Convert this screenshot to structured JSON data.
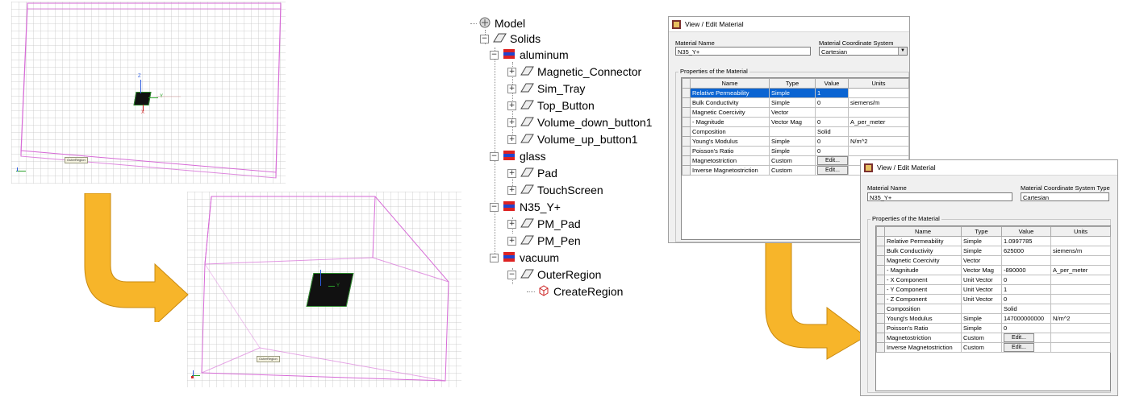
{
  "colors": {
    "region_outline": "#d66ad6",
    "arrow_orange": "#f7b52a",
    "arrow_outline": "#c98a10",
    "selection_blue": "#0a64d2",
    "solid_black": "#111111"
  },
  "viewport_top": {
    "region_tag": "OuterRegion",
    "axis_labels": {
      "z": "Z",
      "y": "Y",
      "x": "X"
    },
    "corner_label": "Z"
  },
  "viewport_bottom": {
    "region_tag": "OuterRegion",
    "axis_labels": {
      "z": "Z",
      "y": "Y"
    }
  },
  "tree": {
    "root": "Model",
    "solids": "Solids",
    "materials": [
      {
        "name": "aluminum",
        "children": [
          "Magnetic_Connector",
          "Sim_Tray",
          "Top_Button",
          "Volume_down_button1",
          "Volume_up_button1"
        ]
      },
      {
        "name": "glass",
        "children": [
          "Pad",
          "TouchScreen"
        ]
      },
      {
        "name": "N35_Y+",
        "children": [
          "PM_Pad",
          "PM_Pen"
        ]
      },
      {
        "name": "vacuum",
        "children": [
          "OuterRegion"
        ]
      }
    ],
    "leaf": "CreateRegion"
  },
  "dialog1": {
    "title": "View / Edit Material",
    "material_name_label": "Material Name",
    "material_name_value": "N35_Y+",
    "coord_label": "Material Coordinate System Type:",
    "coord_value": "Cartesian",
    "props_label": "Properties of the Material",
    "headers": [
      "Name",
      "Type",
      "Value",
      "Units"
    ],
    "rows": [
      [
        "Relative Permeability",
        "Simple",
        "1",
        ""
      ],
      [
        "Bulk Conductivity",
        "Simple",
        "0",
        "siemens/m"
      ],
      [
        "Magnetic Coercivity",
        "Vector",
        "",
        ""
      ],
      [
        "- Magnitude",
        "Vector Mag",
        "0",
        "A_per_meter"
      ],
      [
        "Composition",
        "",
        "Solid",
        ""
      ],
      [
        "Young's Modulus",
        "Simple",
        "0",
        "N/m^2"
      ],
      [
        "Poisson's Ratio",
        "Simple",
        "0",
        ""
      ],
      [
        "Magnetostriction",
        "Custom",
        "Edit...",
        ""
      ],
      [
        "Inverse Magnetostriction",
        "Custom",
        "Edit...",
        ""
      ]
    ]
  },
  "dialog2": {
    "title": "View / Edit Material",
    "material_name_label": "Material Name",
    "material_name_value": "N35_Y+",
    "coord_label": "Material Coordinate System Type",
    "coord_value": "Cartesian",
    "props_label": "Properties of the Material",
    "headers": [
      "Name",
      "Type",
      "Value",
      "Units"
    ],
    "rows": [
      [
        "Relative Permeability",
        "Simple",
        "1.0997785",
        ""
      ],
      [
        "Bulk Conductivity",
        "Simple",
        "625000",
        "siemens/m"
      ],
      [
        "Magnetic Coercivity",
        "Vector",
        "",
        ""
      ],
      [
        "- Magnitude",
        "Vector Mag",
        "-890000",
        "A_per_meter"
      ],
      [
        "- X Component",
        "Unit Vector",
        "0",
        ""
      ],
      [
        "- Y Component",
        "Unit Vector",
        "1",
        ""
      ],
      [
        "- Z Component",
        "Unit Vector",
        "0",
        ""
      ],
      [
        "Composition",
        "",
        "Solid",
        ""
      ],
      [
        "Young's Modulus",
        "Simple",
        "147000000000",
        "N/m^2"
      ],
      [
        "Poisson's Ratio",
        "Simple",
        "0",
        ""
      ],
      [
        "Magnetostriction",
        "Custom",
        "Edit...",
        ""
      ],
      [
        "Inverse Magnetostriction",
        "Custom",
        "Edit...",
        ""
      ]
    ]
  }
}
